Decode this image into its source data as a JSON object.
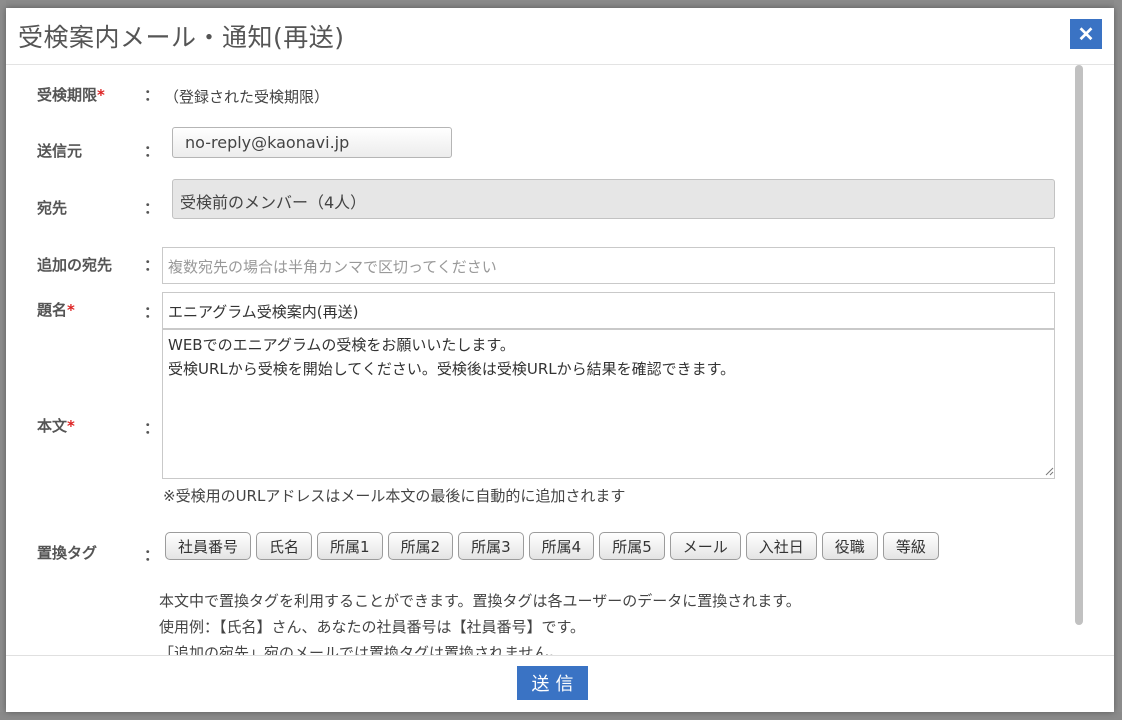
{
  "dialog": {
    "title": "受検案内メール・通知(再送)",
    "close_label": "✕"
  },
  "form": {
    "deadline": {
      "label": "受検期限",
      "value": "（登録された受検期限）"
    },
    "sender": {
      "label": "送信元",
      "value": "no-reply@kaonavi.jp"
    },
    "recipient": {
      "label": "宛先",
      "value": "受検前のメンバー（4人）"
    },
    "extra_recipient": {
      "label": "追加の宛先",
      "value": "",
      "placeholder": "複数宛先の場合は半角カンマで区切ってください"
    },
    "subject": {
      "label": "題名",
      "value": "エニアグラム受検案内(再送)"
    },
    "body": {
      "label": "本文",
      "lines": [
        "WEBでのエニアグラムの受検をお願いいたします。",
        "受検URLから受検を開始してください。受検後は受検URLから結果を確認できます。"
      ],
      "note": "※受検用のURLアドレスはメール本文の最後に自動的に追加されます"
    },
    "tags": {
      "label": "置換タグ",
      "items": [
        "社員番号",
        "氏名",
        "所属1",
        "所属2",
        "所属3",
        "所属4",
        "所属5",
        "メール",
        "入社日",
        "役職",
        "等級"
      ]
    },
    "help": [
      "本文中で置換タグを利用することができます。置換タグは各ユーザーのデータに置換されます。",
      "使用例：【氏名】さん、あなたの社員番号は【社員番号】です。",
      "「追加の宛先」宛のメールでは置換タグは置換されません。"
    ],
    "required_mark": "*",
    "colon": "："
  },
  "footer": {
    "send_label": "送信"
  },
  "colors": {
    "accent": "#3a73c4",
    "required": "#dd2222"
  }
}
